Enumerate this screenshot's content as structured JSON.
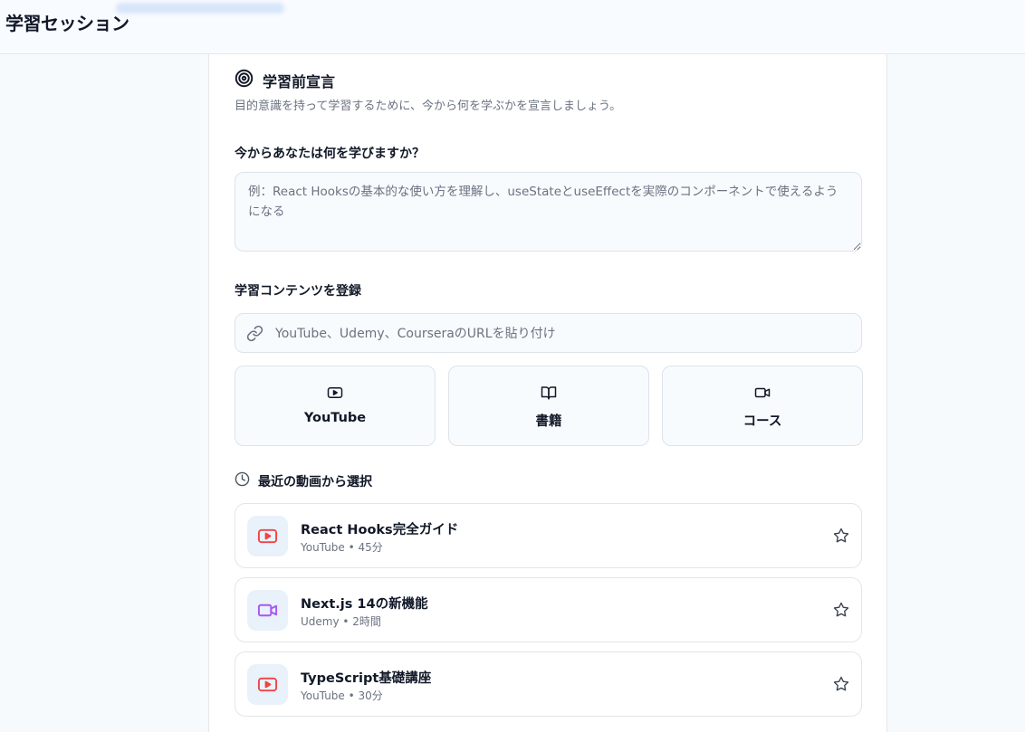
{
  "header": {
    "title": "学習セッション"
  },
  "declaration": {
    "title": "学習前宣言",
    "subtitle": "目的意識を持って学習するために、今から何を学ぶかを宣言しましょう。",
    "question": "今からあなたは何を学びますか？",
    "placeholder": "例：React Hooksの基本的な使い方を理解し、useStateとuseEffectを実際のコンポーネントで使えるようになる",
    "value": ""
  },
  "content": {
    "title": "学習コンテンツを登録",
    "url_placeholder": "YouTube、Udemy、CourseraのURLを貼り付け",
    "url_value": "",
    "types": [
      {
        "label": "YouTube",
        "icon": "youtube-icon"
      },
      {
        "label": "書籍",
        "icon": "book-icon"
      },
      {
        "label": "コース",
        "icon": "video-camera-icon"
      }
    ]
  },
  "recent": {
    "title": "最近の動画から選択",
    "items": [
      {
        "title": "React Hooks完全ガイド",
        "meta": "YouTube • 45分",
        "icon": "youtube-icon",
        "color": "#ef4444"
      },
      {
        "title": "Next.js 14の新機能",
        "meta": "Udemy • 2時間",
        "icon": "video-camera-icon",
        "color": "#a855f7"
      },
      {
        "title": "TypeScript基礎講座",
        "meta": "YouTube • 30分",
        "icon": "youtube-icon",
        "color": "#ef4444"
      }
    ]
  },
  "colors": {
    "youtube": "#ef4444",
    "udemy": "#a855f7",
    "text_primary": "#111827",
    "text_muted": "#6b7280",
    "field_bg": "#f8fbfe",
    "border": "#dde3ea"
  }
}
